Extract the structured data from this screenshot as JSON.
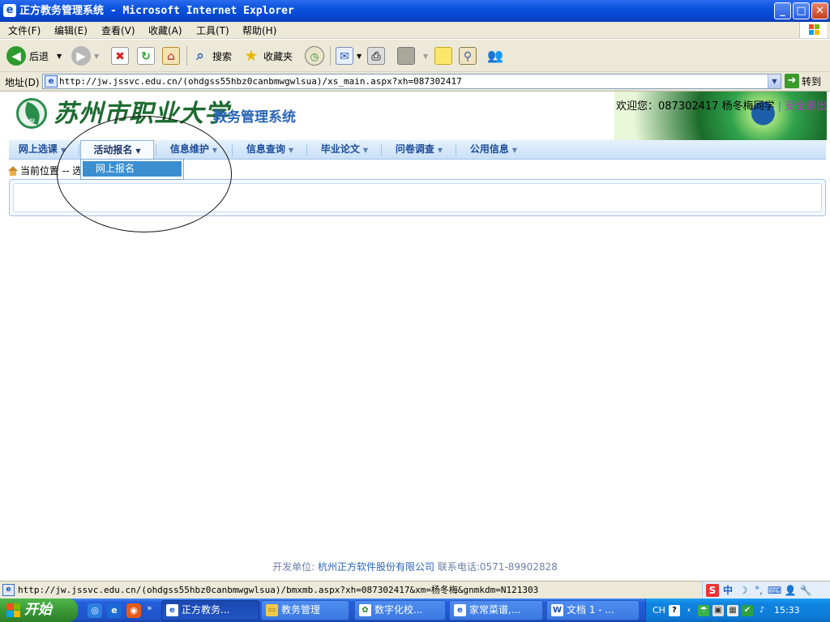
{
  "window": {
    "title": "正方教务管理系统 - Microsoft Internet Explorer",
    "controls": {
      "minimize": "_",
      "maximize": "□",
      "close": "✕"
    }
  },
  "menu": [
    "文件(F)",
    "编辑(E)",
    "查看(V)",
    "收藏(A)",
    "工具(T)",
    "帮助(H)"
  ],
  "toolbar": {
    "back": "后退",
    "search": "搜索",
    "favorites": "收藏夹"
  },
  "address": {
    "label": "地址(D)",
    "url": "http://jw.jssvc.edu.cn/(ohdgss55hbz0canbmwgwlsua)/xs_main.aspx?xh=087302417",
    "go": "转到"
  },
  "page": {
    "school_name": "苏州市职业大学",
    "system_name": "教务管理系统",
    "logo_text": "SVU",
    "welcome": {
      "label": "欢迎您：",
      "user_id": "087302417",
      "user_name": "杨冬梅同学",
      "separator": "|",
      "logout": "安全退出"
    },
    "nav": [
      "网上选课",
      "活动报名",
      "信息维护",
      "信息查询",
      "毕业论文",
      "问卷调查",
      "公用信息"
    ],
    "dropdown": {
      "items": [
        "网上报名"
      ]
    },
    "breadcrumb": "当前位置 -- 选",
    "footer": {
      "dev_label": "开发单位:",
      "company": "杭州正方软件股份有限公司",
      "contact_label": "联系电话:",
      "phone": "0571-89902828"
    }
  },
  "status": {
    "url": "http://jw.jssvc.edu.cn/(ohdgss55hbz0canbmwgwlsua)/bmxmb.aspx?xh=087302417&xm=杨冬梅&gnmkdm=N121303"
  },
  "ime": {
    "lang": "中"
  },
  "taskbar": {
    "start": "开始",
    "tasks": [
      "正方教务...",
      "教务管理",
      "数字化校...",
      "家常菜谱,...",
      "文档 1 - ..."
    ],
    "tray": {
      "lang": "CH",
      "time": "15:33"
    }
  },
  "colors": {
    "accent": "#2b66b8",
    "nav_text": "#1d4d9a",
    "dropdown_highlight": "#3b8fd1",
    "logout": "#b23cbb"
  },
  "icons": [
    "ie-icon",
    "back-icon",
    "forward-icon",
    "stop-icon",
    "refresh-icon",
    "home-icon",
    "search-icon",
    "favorites-icon",
    "history-icon",
    "mail-icon",
    "print-icon",
    "edit-icon",
    "note-icon",
    "research-icon",
    "messenger-icon",
    "go-arrow-icon",
    "windows-logo-icon"
  ]
}
